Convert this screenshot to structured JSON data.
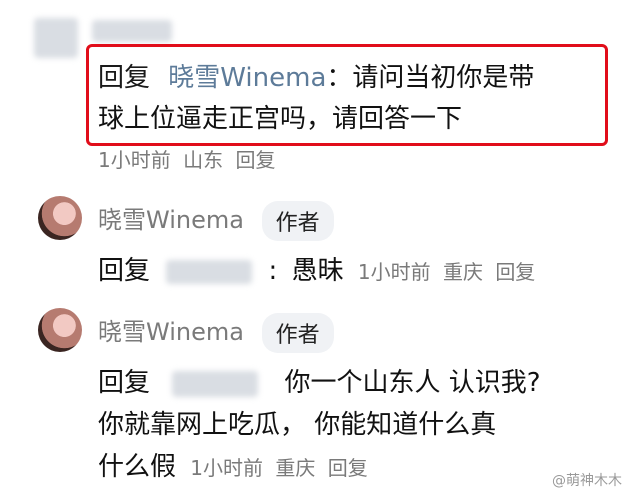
{
  "comment1": {
    "reply_label": "回复",
    "reply_to": "晓雪Winema",
    "colon": "：",
    "text_line1": "请问当初你是带",
    "text_line2": "球上位逼走正宫吗，请回答一下",
    "time": "1小时前",
    "location": "山东",
    "reply_button": "回复"
  },
  "comment2": {
    "author": "晓雪Winema",
    "author_tag": "作者",
    "reply_label": "回复",
    "colon": ":",
    "text": "愚昧",
    "time": "1小时前",
    "location": "重庆",
    "reply_button": "回复"
  },
  "comment3": {
    "author": "晓雪Winema",
    "author_tag": "作者",
    "reply_label": "回复",
    "text_line1": "你一个山东人 认识我?",
    "text_line2": "你就靠网上吃瓜， 你能知道什么真",
    "text_line3": "什么假",
    "time": "1小时前",
    "location": "重庆",
    "reply_button": "回复"
  },
  "watermark": "@萌神木木",
  "colors": {
    "highlight": "#e10d1a",
    "muted": "#7a7a7a",
    "tag_bg": "#f0f2f5"
  }
}
